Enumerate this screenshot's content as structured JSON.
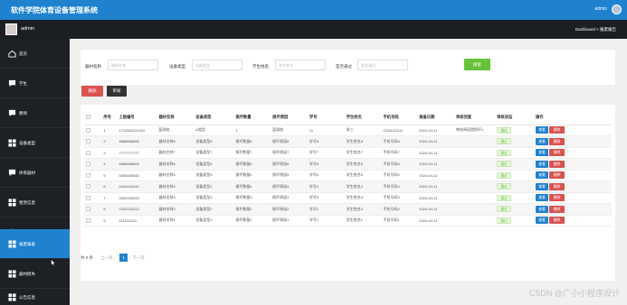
{
  "app": {
    "title": "软件学院体育设备管理系统",
    "top_user": "admin"
  },
  "subbar": {
    "user": "admin",
    "breadcrumb": "Dashboard > 报废报告"
  },
  "sidebar": {
    "items": [
      {
        "label": "首页",
        "icon": "home-icon",
        "active": false
      },
      {
        "label": "学生",
        "icon": "chat-icon",
        "active": false
      },
      {
        "label": "教师",
        "icon": "chat-icon",
        "active": false
      },
      {
        "label": "设备类型",
        "icon": "grid-icon",
        "active": false
      },
      {
        "label": "体育器材",
        "icon": "chat-icon",
        "active": false
      },
      {
        "label": "租赁信息",
        "icon": "grid-icon",
        "active": false
      },
      {
        "label": "归还信息",
        "icon": "person-icon",
        "active": false
      },
      {
        "label": "报废报备",
        "icon": "grid-icon",
        "active": true
      },
      {
        "label": "器材损失",
        "icon": "grid-icon",
        "active": false
      },
      {
        "label": "公告信息",
        "icon": "grid-icon",
        "active": false
      }
    ]
  },
  "search": {
    "name_label": "器材名称",
    "name_placeholder": "器材名称",
    "type_label": "设备类型",
    "type_placeholder": "设备类型",
    "student_label": "学生姓名",
    "student_placeholder": "学生姓名",
    "approved_label": "是否通过",
    "approved_placeholder": "是否通过",
    "search_button": "搜索"
  },
  "actions": {
    "delete": "删除",
    "audit": "审核"
  },
  "table": {
    "headers": [
      "",
      "序号",
      "上报编号",
      "器材名称",
      "设备类型",
      "损坏数量",
      "损坏原因",
      "学号",
      "学生姓名",
      "手机号码",
      "报备日期",
      "审核回复",
      "审核状态",
      "操作"
    ],
    "rows": [
      {
        "idx": "1",
        "code": "1712802220420",
        "name": "篮球拍",
        "type": "A类型",
        "qty": "1",
        "reason": "篮球拍",
        "sno": "11",
        "sname": "张三",
        "phone": "13111111111",
        "date": "2024-04-11",
        "reply": "审核原因是损坏1",
        "status": "通过"
      },
      {
        "idx": "2",
        "code": "8888888888",
        "name": "器材名称8",
        "type": "设备类型8",
        "qty": "损坏数量8",
        "reason": "损坏原因8",
        "sno": "学号8",
        "sname": "学生姓名8",
        "phone": "手机号码8",
        "date": "2024-04-11",
        "reply": "",
        "status": "通过"
      },
      {
        "idx": "3",
        "code": "7777777777",
        "name": "器材名称7",
        "type": "设备类型7",
        "qty": "损坏数量7",
        "reason": "损坏原因7",
        "sno": "学号7",
        "sname": "学生姓名7",
        "phone": "手机号码7",
        "date": "2024-04-11",
        "reply": "",
        "status": "通过"
      },
      {
        "idx": "4",
        "code": "6666666666",
        "name": "器材名称6",
        "type": "设备类型6",
        "qty": "损坏数量6",
        "reason": "损坏原因6",
        "sno": "学号6",
        "sname": "学生姓名6",
        "phone": "手机号码6",
        "date": "2024-04-11",
        "reply": "",
        "status": "通过"
      },
      {
        "idx": "5",
        "code": "5555555555",
        "name": "器材名称5",
        "type": "设备类型5",
        "qty": "损坏数量5",
        "reason": "损坏原因5",
        "sno": "学号5",
        "sname": "学生姓名5",
        "phone": "手机号码5",
        "date": "2024-04-11",
        "reply": "",
        "status": "通过"
      },
      {
        "idx": "6",
        "code": "4444444444",
        "name": "器材名称4",
        "type": "设备类型4",
        "qty": "损坏数量4",
        "reason": "损坏原因4",
        "sno": "学号4",
        "sname": "学生姓名4",
        "phone": "手机号码4",
        "date": "2024-04-11",
        "reply": "",
        "status": "通过"
      },
      {
        "idx": "7",
        "code": "3333333333",
        "name": "器材名称3",
        "type": "设备类型3",
        "qty": "损坏数量3",
        "reason": "损坏原因3",
        "sno": "学号3",
        "sname": "学生姓名3",
        "phone": "手机号码3",
        "date": "2024-04-11",
        "reply": "",
        "status": "通过"
      },
      {
        "idx": "8",
        "code": "2222222222",
        "name": "器材名称2",
        "type": "设备类型2",
        "qty": "损坏数量2",
        "reason": "损坏原因2",
        "sno": "学号2",
        "sname": "学生姓名2",
        "phone": "手机号码2",
        "date": "2024-04-11",
        "reply": "",
        "status": "通过"
      },
      {
        "idx": "9",
        "code": "1111111111",
        "name": "器材名称1",
        "type": "设备类型1",
        "qty": "损坏数量1",
        "reason": "损坏原因1",
        "sno": "学号1",
        "sname": "学生姓名1",
        "phone": "手机号码1",
        "date": "2024-04-11",
        "reply": "",
        "status": "通过"
      }
    ],
    "view_label": "查看",
    "delete_label": "删除"
  },
  "pager": {
    "total": "共 9 条",
    "prev": "上一页",
    "current": "1",
    "next": "下一页"
  },
  "watermark": "CSDN @广小小程序设计",
  "colors": {
    "primary": "#1f82cf",
    "success": "#67c23a",
    "danger": "#d9534f",
    "sidebar": "#1d2024"
  }
}
